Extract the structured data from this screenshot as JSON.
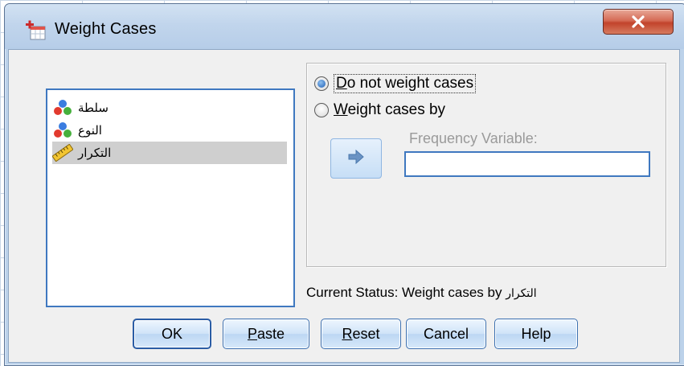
{
  "window": {
    "title": "Weight Cases",
    "close_icon": "close-icon"
  },
  "variables": [
    {
      "label": "سلطة",
      "icon": "nominal-variable-icon"
    },
    {
      "label": "النوع",
      "icon": "nominal-variable-icon"
    },
    {
      "label": "التكرار",
      "icon": "scale-variable-icon",
      "selected": true
    }
  ],
  "options": {
    "do_not_weight": {
      "first": "D",
      "rest": "o not weight cases",
      "checked": true
    },
    "weight_by": {
      "first": "W",
      "rest": "eight cases by",
      "checked": false
    }
  },
  "frequency": {
    "label": "Frequency Variable:",
    "value": ""
  },
  "status": {
    "text": "Current Status: Weight cases by ",
    "variable": "التكرار"
  },
  "buttons": {
    "ok": "OK",
    "paste_first": "P",
    "paste_rest": "aste",
    "reset_first": "R",
    "reset_rest": "eset",
    "cancel": "Cancel",
    "help": "Help"
  },
  "colors": {
    "accent_border": "#3f78c0",
    "close_red": "#c2432b",
    "selected_row": "#cfcfcf"
  }
}
